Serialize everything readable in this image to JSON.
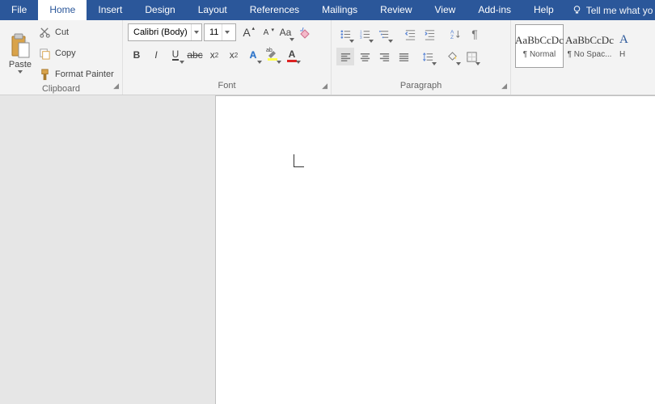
{
  "menu": {
    "tabs": [
      "File",
      "Home",
      "Insert",
      "Design",
      "Layout",
      "References",
      "Mailings",
      "Review",
      "View",
      "Add-ins",
      "Help"
    ],
    "active_index": 1,
    "tell_me": "Tell me what yo"
  },
  "ribbon": {
    "clipboard": {
      "label": "Clipboard",
      "paste": "Paste",
      "cut": "Cut",
      "copy": "Copy",
      "format_painter": "Format Painter"
    },
    "font": {
      "label": "Font",
      "font_name": "Calibri (Body)",
      "font_size": "11",
      "grow": "A",
      "shrink": "A",
      "caps": "Aa",
      "bold": "B",
      "italic": "I",
      "underline": "U",
      "strike": "abc",
      "sub": "x",
      "sub2": "2",
      "sup": "x",
      "sup2": "2",
      "text_effects": "A",
      "highlight": "ab",
      "font_color": "A"
    },
    "paragraph": {
      "label": "Paragraph"
    },
    "styles": {
      "items": [
        {
          "preview": "AaBbCcDc",
          "name": "¶ Normal"
        },
        {
          "preview": "AaBbCcDc",
          "name": "¶ No Spac..."
        }
      ],
      "heading_letter": "A",
      "heading_name": "H"
    }
  }
}
